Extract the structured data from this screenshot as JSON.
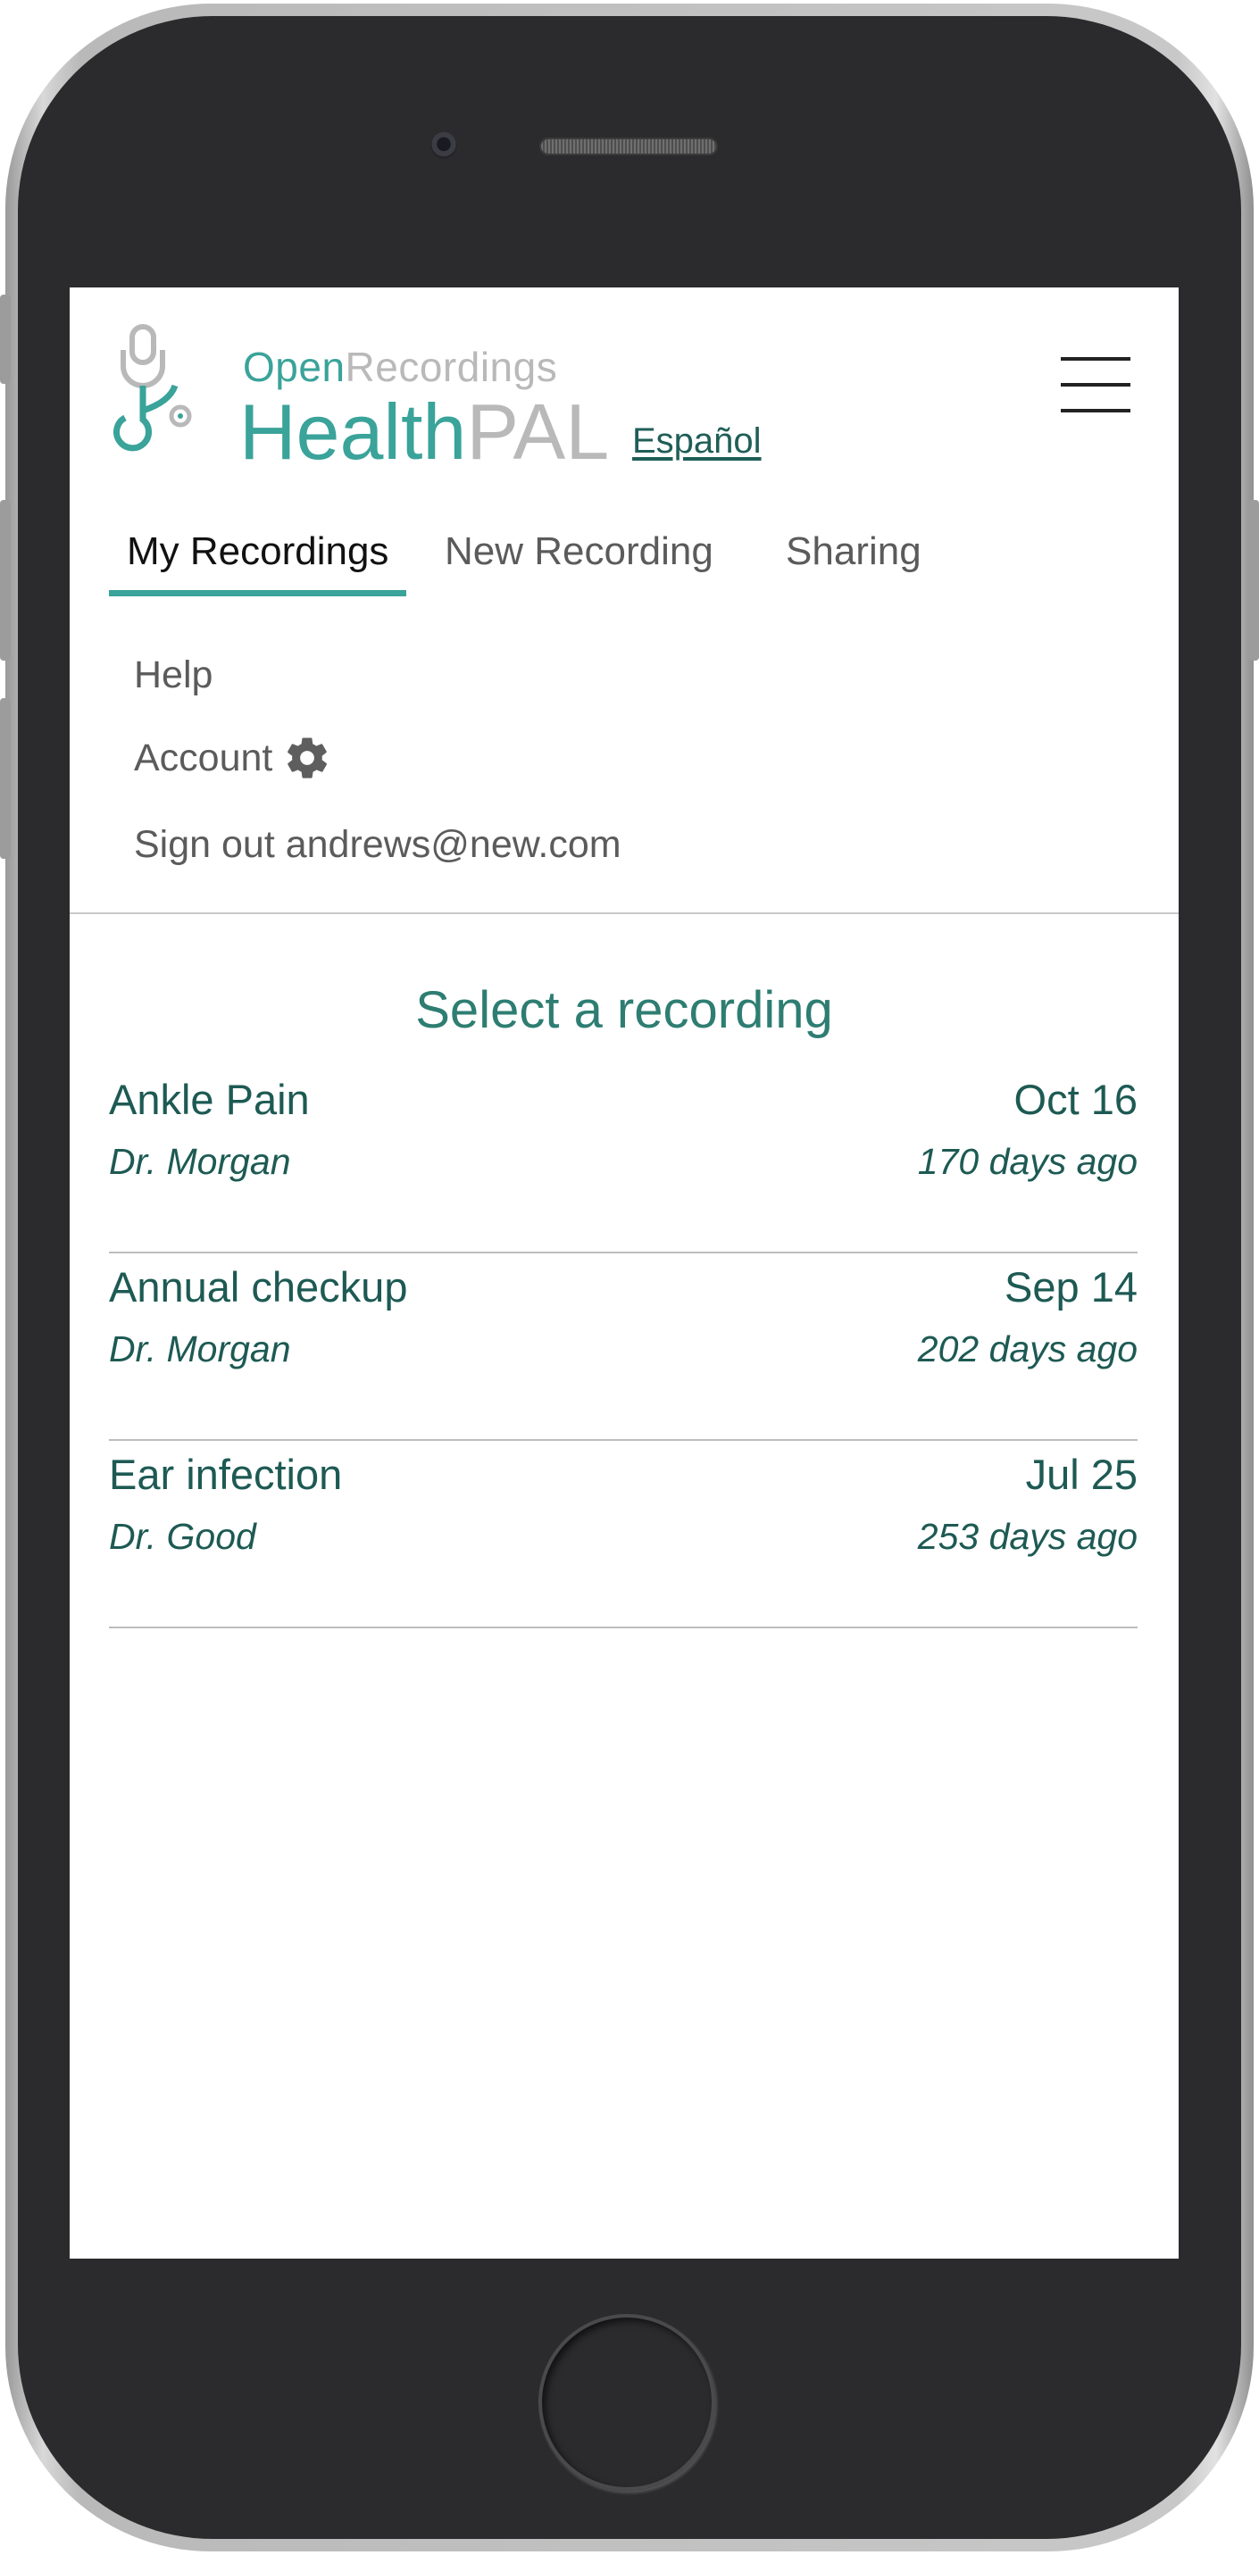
{
  "brand": {
    "prefix_accent": "Open",
    "prefix_rest": "Recordings",
    "name_accent": "Health",
    "name_rest": "PAL"
  },
  "language_link": "Español",
  "tabs": [
    {
      "label": "My Recordings",
      "active": true
    },
    {
      "label": "New Recording",
      "active": false
    },
    {
      "label": "Sharing",
      "active": false
    }
  ],
  "menu": {
    "help": "Help",
    "account": "Account",
    "sign_out": "Sign out andrews@new.com"
  },
  "heading": "Select a recording",
  "recordings": [
    {
      "title": "Ankle Pain",
      "date": "Oct 16",
      "doctor": "Dr. Morgan",
      "ago": "170 days ago"
    },
    {
      "title": "Annual checkup",
      "date": "Sep 14",
      "doctor": "Dr. Morgan",
      "ago": "202 days ago"
    },
    {
      "title": "Ear infection",
      "date": "Jul 25",
      "doctor": "Dr. Good",
      "ago": "253 days ago"
    }
  ],
  "icons": {
    "logo": "stethoscope-microphone-logo",
    "menu": "hamburger-menu-icon",
    "account": "gear-icon"
  },
  "colors": {
    "accent": "#3aa39a",
    "text_dark_teal": "#1d5a53",
    "heading": "#2e7d72",
    "muted": "#b9b9b9",
    "device_frame": "#2b2b2d"
  }
}
